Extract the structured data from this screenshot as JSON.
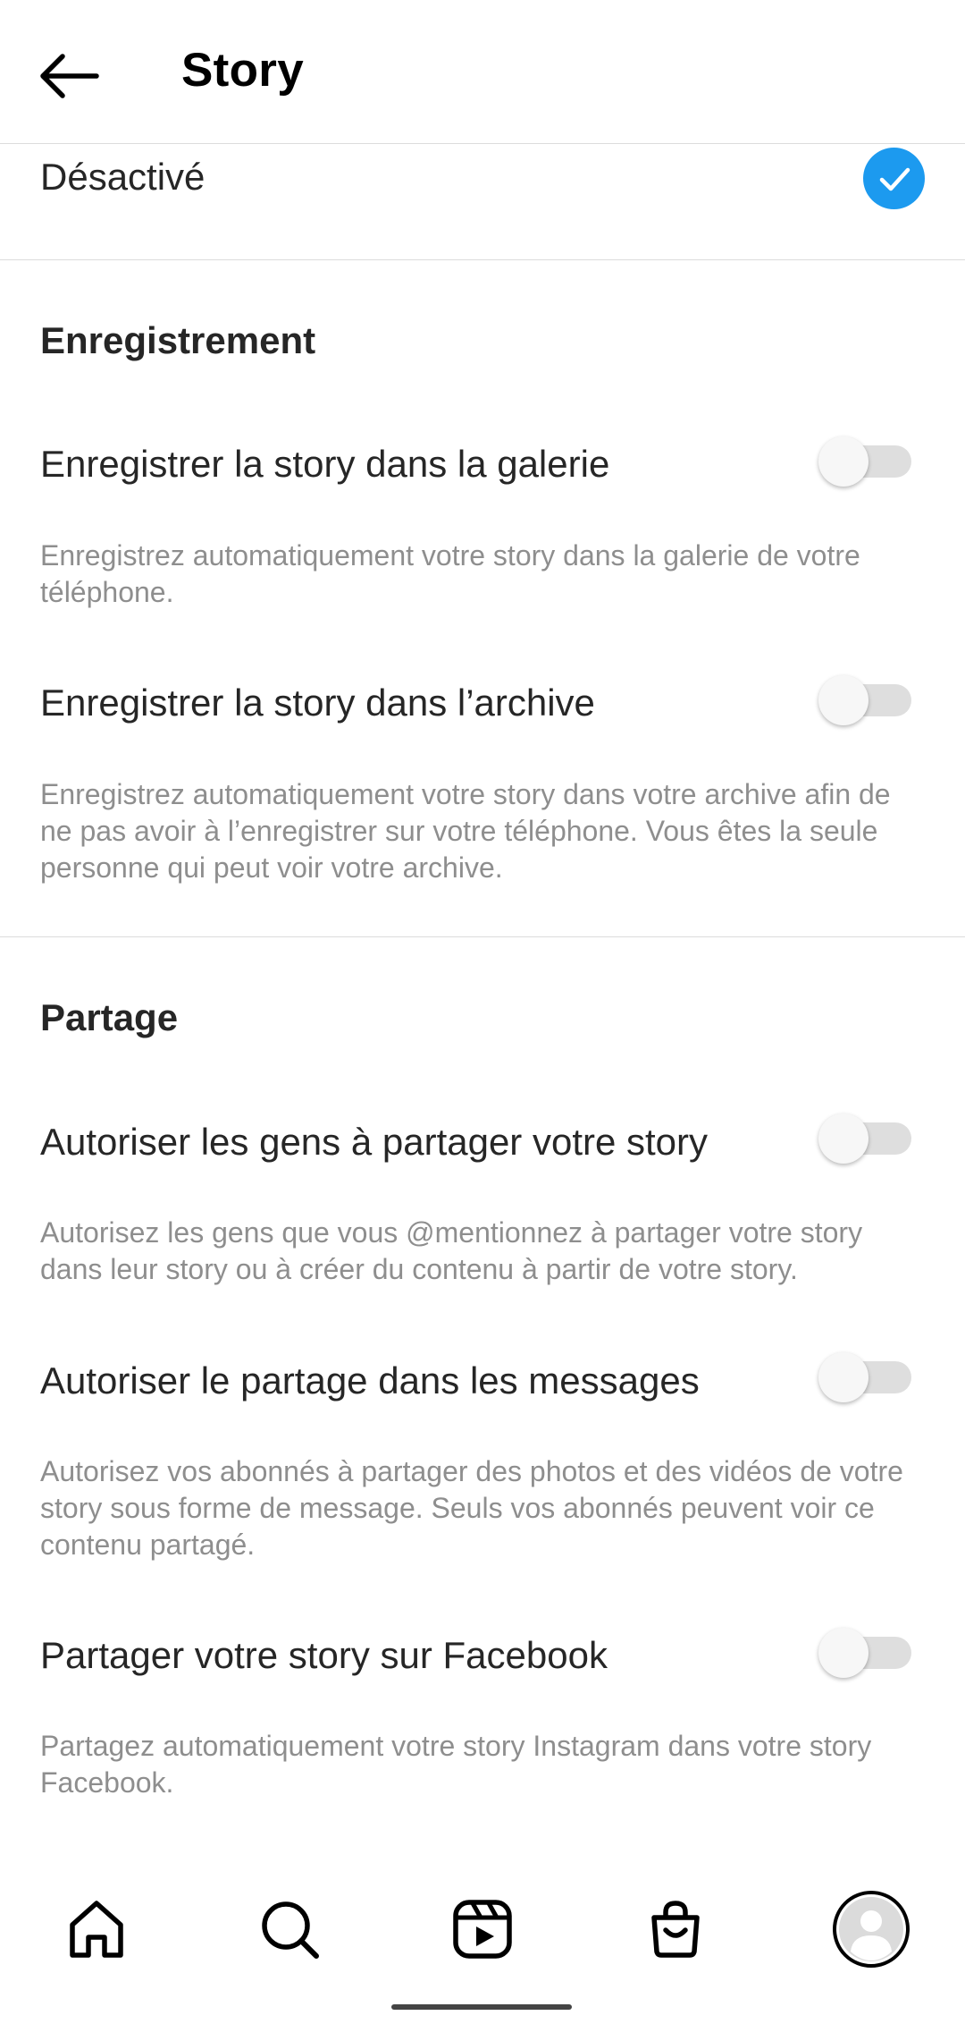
{
  "header": {
    "title": "Story",
    "back_icon": "arrow-left-icon"
  },
  "visibility": {
    "selected_option": "Désactivé",
    "check_color": "#1c9aef"
  },
  "saving": {
    "title": "Enregistrement",
    "items": [
      {
        "label": "Enregistrer la story dans la galerie",
        "description": "Enregistrez automatiquement votre story dans la galerie de votre téléphone.",
        "enabled": false
      },
      {
        "label": "Enregistrer la story dans l’archive",
        "description": "Enregistrez automatiquement votre story dans votre archive afin de ne pas avoir à l’enregistrer sur votre téléphone. Vous êtes la seule personne qui peut voir votre archive.",
        "enabled": false
      }
    ]
  },
  "sharing": {
    "title": "Partage",
    "items": [
      {
        "label": "Autoriser les gens à partager votre story",
        "description": "Autorisez les gens que vous @mentionnez à partager votre story dans leur story ou à créer du contenu à partir de votre story.",
        "enabled": false
      },
      {
        "label": "Autoriser le partage dans les messages",
        "description": "Autorisez vos abonnés à partager des photos et des vidéos de votre story sous forme de message. Seuls vos abonnés peuvent voir ce contenu partagé.",
        "enabled": false
      },
      {
        "label": "Partager votre story sur Facebook",
        "description": "Partagez automatiquement votre story Instagram dans votre story Facebook.",
        "enabled": false
      }
    ]
  },
  "bottom_nav": {
    "items": [
      "home-icon",
      "search-icon",
      "reels-icon",
      "shop-icon",
      "profile-avatar-icon"
    ]
  }
}
